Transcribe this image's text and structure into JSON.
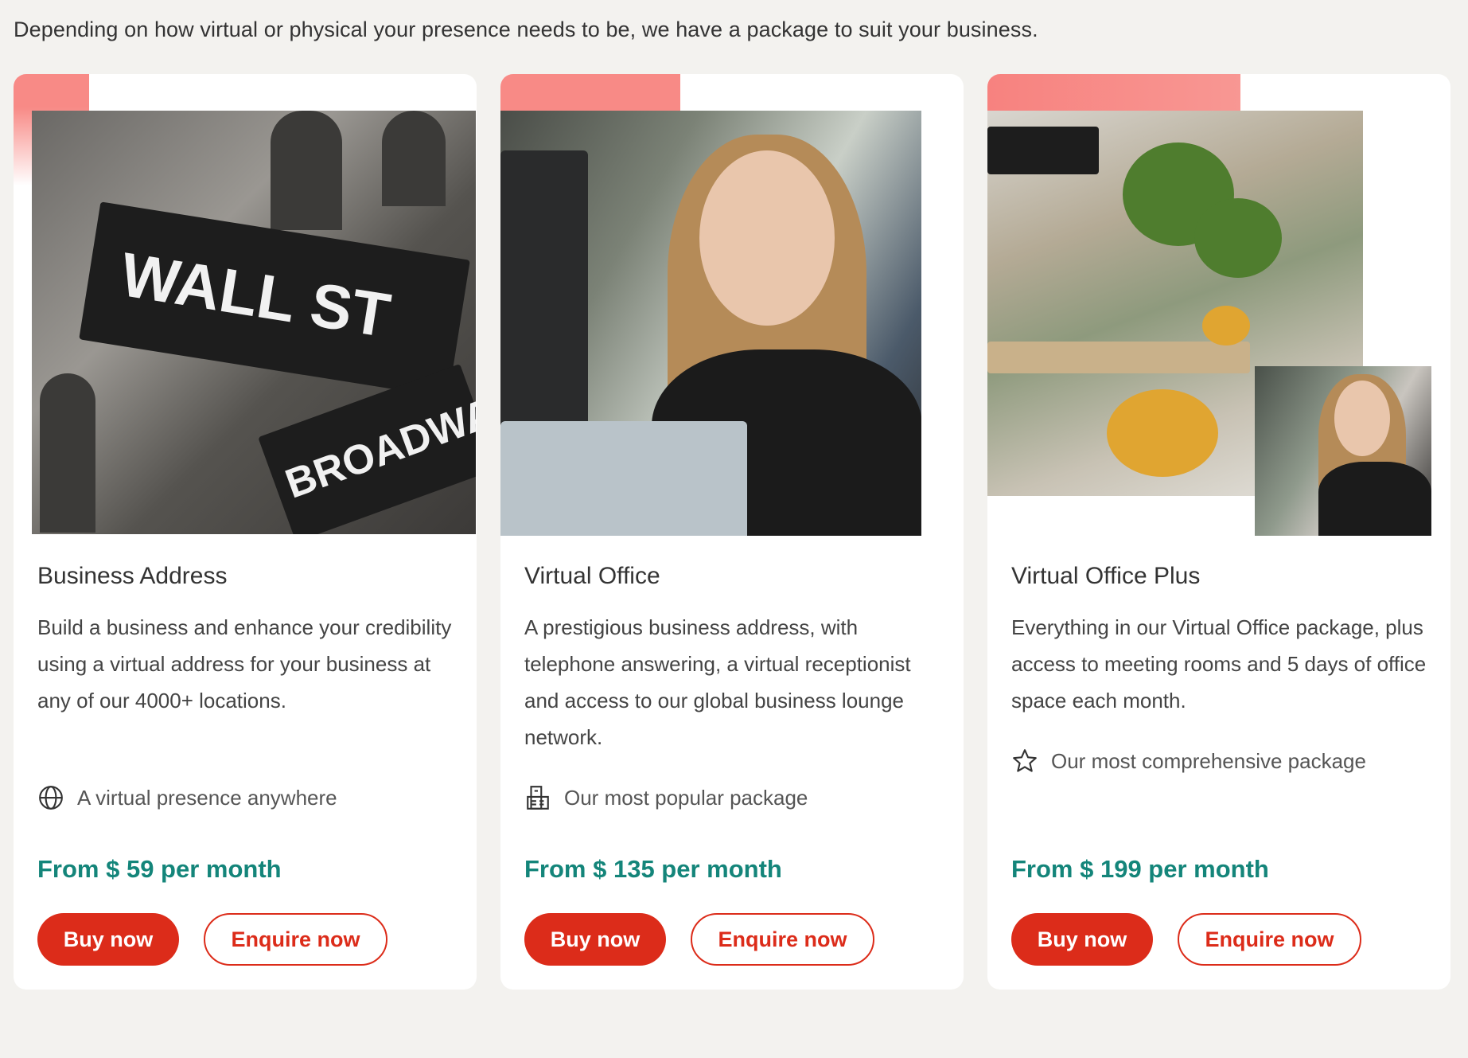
{
  "intro": "Depending on how virtual or physical your presence needs to be, we have a package to suit your business.",
  "cards": [
    {
      "title": "Business Address",
      "description": "Build a business and enhance your credibility using a virtual address for your business at any of our 4000+ locations.",
      "feature_icon": "globe-icon",
      "feature": "A virtual presence anywhere",
      "price": "From $ 59 per month",
      "buy_label": "Buy now",
      "enquire_label": "Enquire now",
      "sign_main": "WALL ST",
      "sign_secondary": "BROADWAY"
    },
    {
      "title": "Virtual Office",
      "description": "A prestigious business address, with telephone answering, a virtual receptionist and access to our global business lounge network.",
      "feature_icon": "building-icon",
      "feature": "Our most popular package",
      "price": "From $ 135 per month",
      "buy_label": "Buy now",
      "enquire_label": "Enquire now"
    },
    {
      "title": "Virtual Office Plus",
      "description": "Everything in our Virtual Office package, plus access to meeting rooms and 5 days of office space each month.",
      "feature_icon": "star-icon",
      "feature": "Our most comprehensive package",
      "price": "From $ 199 per month",
      "buy_label": "Buy now",
      "enquire_label": "Enquire now"
    }
  ],
  "colors": {
    "page_bg": "#f3f2ef",
    "accent": "#f88a86",
    "price": "#14857a",
    "button": "#dc2c1a"
  }
}
